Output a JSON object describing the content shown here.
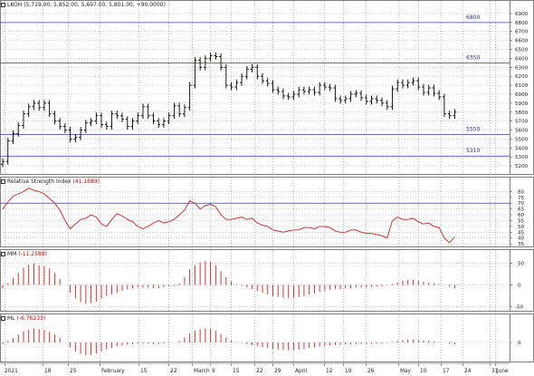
{
  "panes": {
    "price": {
      "symbol": "LKOH",
      "ohlc_text": "(5,719.00, 5,852.00, 5,697.00, 5,801.00, +90.0000)"
    },
    "rsi": {
      "label": "Relative Strength Index",
      "value_text": "(41.1689)"
    },
    "mm": {
      "label": "MM",
      "value_text": "(-11.2588)"
    },
    "ml": {
      "label": "ML",
      "value_text": "(-6.76233)"
    }
  },
  "x_axis": {
    "labels": [
      "2021",
      "18",
      "25",
      "February",
      "15",
      "22",
      "March",
      "9",
      "15",
      "22",
      "29",
      "April",
      "12",
      "19",
      "26",
      "May",
      "10",
      "17",
      "24",
      "31",
      "June"
    ]
  },
  "colors": {
    "price_candles": "#000000",
    "horizontal_levels": "#3a3a9a",
    "level_labels": "#2a2ab0",
    "rsi_line": "#cc2222",
    "histogram": "#cc2222",
    "grid": "#9a9a9a"
  },
  "chart_data": [
    {
      "type": "line",
      "title": "LKOH",
      "subtype": "ohlc",
      "y_ticks": [
        5200,
        5300,
        5400,
        5500,
        5600,
        5700,
        5800,
        5900,
        6000,
        6100,
        6200,
        6300,
        6400,
        6500,
        6600,
        6700,
        6800,
        6900
      ],
      "ylim": [
        5100,
        6950
      ],
      "levels": [
        {
          "value": 6800,
          "label": "6800"
        },
        {
          "value": 6350,
          "label": "6350"
        },
        {
          "value": 5550,
          "label": "5550"
        },
        {
          "value": 5310,
          "label": "5310"
        }
      ],
      "close": [
        5250,
        5480,
        5560,
        5650,
        5780,
        5860,
        5900,
        5850,
        5900,
        5780,
        5700,
        5640,
        5600,
        5500,
        5520,
        5600,
        5680,
        5700,
        5760,
        5660,
        5640,
        5780,
        5760,
        5720,
        5640,
        5700,
        5760,
        5860,
        5760,
        5700,
        5660,
        5700,
        5760,
        5870,
        5780,
        5850,
        6100,
        6380,
        6300,
        6400,
        6430,
        6420,
        6300,
        6100,
        6080,
        6130,
        6200,
        6280,
        6300,
        6200,
        6150,
        6120,
        6050,
        6030,
        5980,
        5970,
        6000,
        6050,
        6030,
        6050,
        6020,
        6100,
        6080,
        6070,
        5950,
        5930,
        5950,
        6000,
        6010,
        5960,
        5920,
        5950,
        5930,
        5900,
        5860,
        6060,
        6130,
        6100,
        6130,
        6150,
        6080,
        6020,
        6070,
        6010,
        5970,
        5780,
        5760,
        5800
      ]
    },
    {
      "type": "line",
      "title": "Relative Strength Index",
      "y_ticks": [
        35,
        40,
        45,
        50,
        55,
        60,
        65,
        70,
        75,
        80
      ],
      "ylim": [
        32,
        85
      ],
      "levels": [
        70,
        30
      ],
      "values": [
        65,
        71,
        76,
        78,
        80,
        83,
        81,
        80,
        78,
        74,
        70,
        64,
        55,
        48,
        52,
        56,
        57,
        60,
        58,
        52,
        50,
        56,
        61,
        59,
        56,
        54,
        50,
        48,
        50,
        53,
        55,
        53,
        54,
        56,
        60,
        64,
        72,
        70,
        65,
        68,
        69,
        67,
        60,
        56,
        56,
        57,
        58,
        56,
        57,
        53,
        51,
        50,
        47,
        46,
        45,
        46,
        47,
        47,
        49,
        49,
        48,
        50,
        50,
        49,
        46,
        45,
        45,
        47,
        47,
        45,
        44,
        44,
        43,
        42,
        40,
        55,
        58,
        56,
        56,
        57,
        54,
        52,
        53,
        50,
        49,
        40,
        36,
        41
      ]
    },
    {
      "type": "bar",
      "title": "MM",
      "y_ticks": [
        -50,
        0,
        50
      ],
      "ylim": [
        -62,
        62
      ],
      "values": [
        -8,
        4,
        16,
        28,
        40,
        47,
        50,
        46,
        44,
        38,
        28,
        14,
        0,
        -18,
        -30,
        -40,
        -44,
        -42,
        -38,
        -32,
        -26,
        -22,
        -18,
        -14,
        -10,
        -8,
        -6,
        -6,
        -6,
        -8,
        -8,
        -6,
        -4,
        -2,
        4,
        18,
        36,
        46,
        52,
        56,
        54,
        46,
        32,
        18,
        8,
        2,
        -2,
        -6,
        -10,
        -14,
        -18,
        -22,
        -26,
        -28,
        -30,
        -30,
        -30,
        -28,
        -26,
        -22,
        -20,
        -16,
        -14,
        -12,
        -10,
        -10,
        -8,
        -8,
        -6,
        -6,
        -6,
        -4,
        -4,
        -4,
        -2,
        2,
        6,
        10,
        12,
        12,
        10,
        8,
        6,
        4,
        2,
        0,
        -4,
        -8
      ]
    },
    {
      "type": "bar",
      "title": "ML",
      "y_ticks": [
        0
      ],
      "ylim": [
        -40,
        40
      ],
      "values": [
        -3,
        3,
        9,
        16,
        22,
        26,
        28,
        27,
        25,
        21,
        16,
        9,
        0,
        -10,
        -18,
        -23,
        -26,
        -25,
        -22,
        -18,
        -14,
        -11,
        -8,
        -6,
        -4,
        -3,
        -2,
        -2,
        -2,
        -3,
        -3,
        -2,
        -1,
        0,
        3,
        10,
        18,
        24,
        27,
        29,
        28,
        24,
        17,
        10,
        4,
        1,
        -1,
        -3,
        -5,
        -7,
        -9,
        -11,
        -13,
        -14,
        -15,
        -15,
        -15,
        -14,
        -13,
        -11,
        -10,
        -8,
        -7,
        -6,
        -5,
        -5,
        -4,
        -4,
        -3,
        -3,
        -3,
        -2,
        -2,
        -2,
        -1,
        1,
        3,
        5,
        6,
        6,
        5,
        4,
        3,
        2,
        1,
        0,
        -2,
        -4
      ]
    }
  ]
}
